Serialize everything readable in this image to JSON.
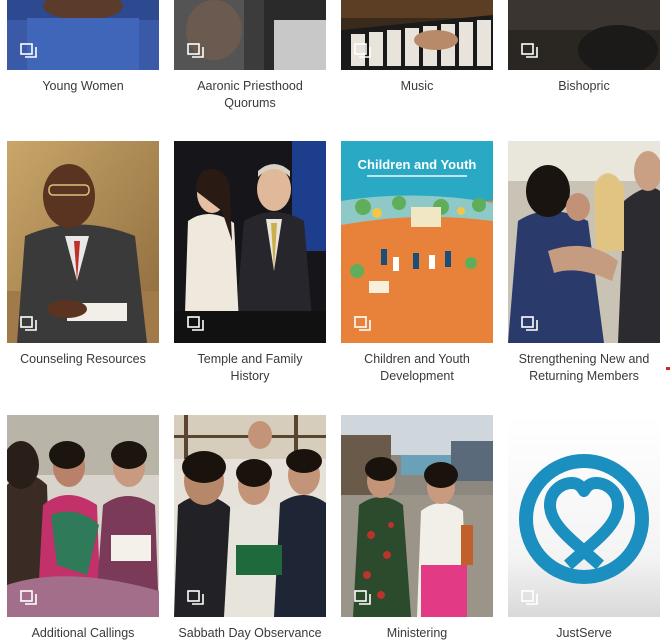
{
  "cards": [
    {
      "label": "Young Women",
      "icon": "collection-icon"
    },
    {
      "label": "Aaronic Priesthood Quorums",
      "icon": "collection-icon"
    },
    {
      "label": "Music",
      "icon": "collection-icon"
    },
    {
      "label": "Bishopric",
      "icon": "collection-icon"
    },
    {
      "label": "Counseling Resources",
      "icon": "collection-icon"
    },
    {
      "label": "Temple and Family History",
      "icon": "collection-icon"
    },
    {
      "label": "Children and Youth Development",
      "icon": "collection-icon"
    },
    {
      "label": "Strengthening New and Returning Members",
      "icon": "collection-icon"
    },
    {
      "label": "Additional Callings",
      "icon": "collection-icon"
    },
    {
      "label": "Sabbath Day Observance",
      "icon": "collection-icon"
    },
    {
      "label": "Ministering",
      "icon": "collection-icon"
    },
    {
      "label": "JustServe",
      "icon": "collection-icon"
    }
  ],
  "children_youth_cover": {
    "title": "Children and Youth"
  },
  "colors": {
    "justserve_blue": "#1a8fc0",
    "children_youth_teal": "#29a9c4",
    "children_youth_orange": "#e8823a"
  }
}
